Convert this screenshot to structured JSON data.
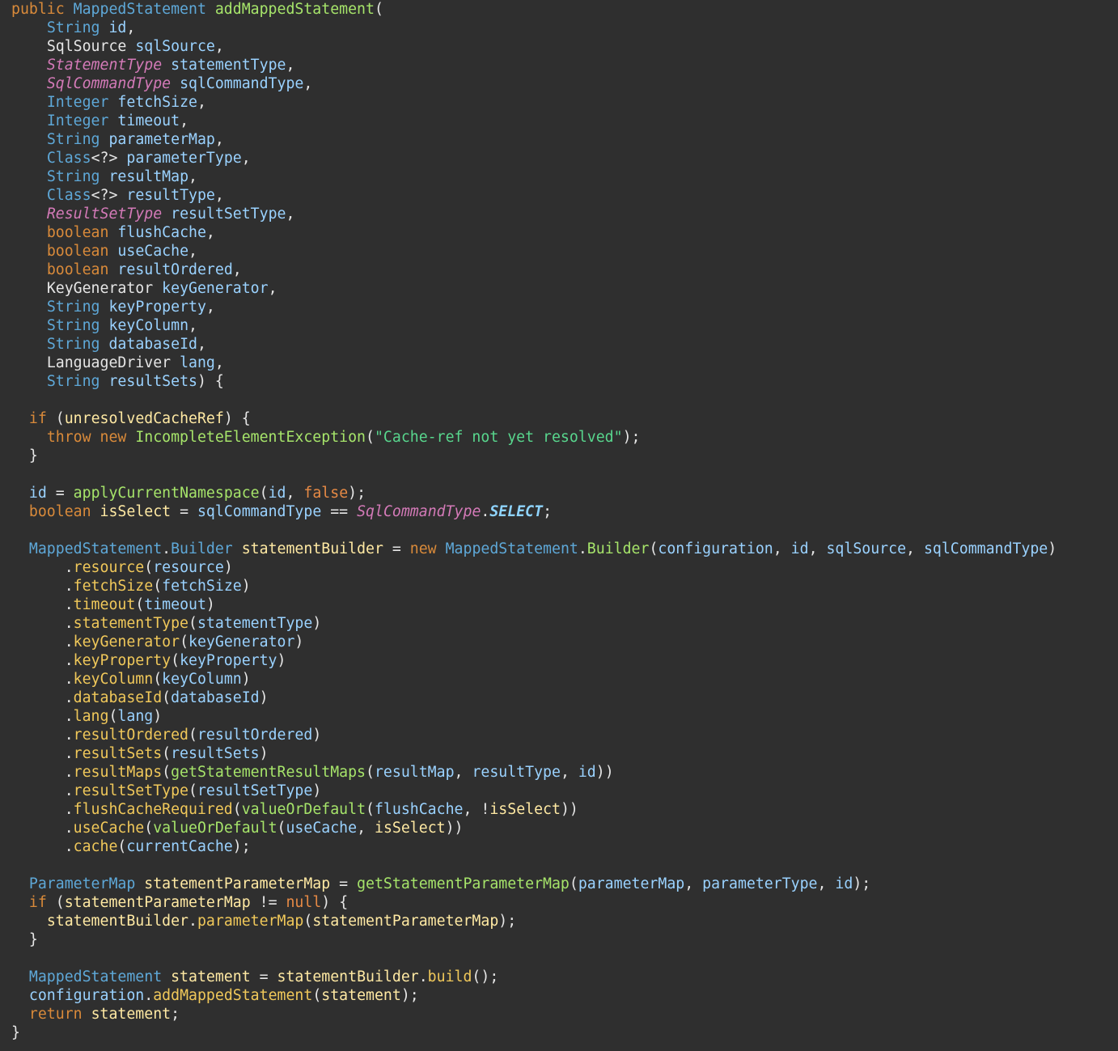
{
  "colors": {
    "background": "#2f2f2f",
    "keyword": "#d98a3a",
    "type": "#5ea8d8",
    "type_plain": "#e6e6e6",
    "enum_type": "#d47ab8",
    "variable": "#ffe9a3",
    "parameter": "#9ad2ff",
    "method": "#f0c85a",
    "method_call": "#a6e46a",
    "string": "#58d68d",
    "constant": "#8fd4ff",
    "literal": "#e78a45",
    "punctuation": "#e6e6e6"
  },
  "code": {
    "lines": [
      [
        [
          "kw",
          "public "
        ],
        [
          "type",
          "MappedStatement "
        ],
        [
          "mcall",
          "addMappedStatement"
        ],
        [
          "punc",
          "("
        ]
      ],
      [
        [
          "punc",
          "    "
        ],
        [
          "type",
          "String "
        ],
        [
          "param",
          "id"
        ],
        [
          "punc",
          ","
        ]
      ],
      [
        [
          "punc",
          "    "
        ],
        [
          "plaintype",
          "SqlSource "
        ],
        [
          "param",
          "sqlSource"
        ],
        [
          "punc",
          ","
        ]
      ],
      [
        [
          "punc",
          "    "
        ],
        [
          "enum",
          "StatementType "
        ],
        [
          "param",
          "statementType"
        ],
        [
          "punc",
          ","
        ]
      ],
      [
        [
          "punc",
          "    "
        ],
        [
          "enum",
          "SqlCommandType "
        ],
        [
          "param",
          "sqlCommandType"
        ],
        [
          "punc",
          ","
        ]
      ],
      [
        [
          "punc",
          "    "
        ],
        [
          "type",
          "Integer "
        ],
        [
          "param",
          "fetchSize"
        ],
        [
          "punc",
          ","
        ]
      ],
      [
        [
          "punc",
          "    "
        ],
        [
          "type",
          "Integer "
        ],
        [
          "param",
          "timeout"
        ],
        [
          "punc",
          ","
        ]
      ],
      [
        [
          "punc",
          "    "
        ],
        [
          "type",
          "String "
        ],
        [
          "param",
          "parameterMap"
        ],
        [
          "punc",
          ","
        ]
      ],
      [
        [
          "punc",
          "    "
        ],
        [
          "type",
          "Class"
        ],
        [
          "punc",
          "<?> "
        ],
        [
          "param",
          "parameterType"
        ],
        [
          "punc",
          ","
        ]
      ],
      [
        [
          "punc",
          "    "
        ],
        [
          "type",
          "String "
        ],
        [
          "param",
          "resultMap"
        ],
        [
          "punc",
          ","
        ]
      ],
      [
        [
          "punc",
          "    "
        ],
        [
          "type",
          "Class"
        ],
        [
          "punc",
          "<?> "
        ],
        [
          "param",
          "resultType"
        ],
        [
          "punc",
          ","
        ]
      ],
      [
        [
          "punc",
          "    "
        ],
        [
          "enum",
          "ResultSetType "
        ],
        [
          "param",
          "resultSetType"
        ],
        [
          "punc",
          ","
        ]
      ],
      [
        [
          "punc",
          "    "
        ],
        [
          "kw",
          "boolean "
        ],
        [
          "param",
          "flushCache"
        ],
        [
          "punc",
          ","
        ]
      ],
      [
        [
          "punc",
          "    "
        ],
        [
          "kw",
          "boolean "
        ],
        [
          "param",
          "useCache"
        ],
        [
          "punc",
          ","
        ]
      ],
      [
        [
          "punc",
          "    "
        ],
        [
          "kw",
          "boolean "
        ],
        [
          "param",
          "resultOrdered"
        ],
        [
          "punc",
          ","
        ]
      ],
      [
        [
          "punc",
          "    "
        ],
        [
          "plaintype",
          "KeyGenerator "
        ],
        [
          "param",
          "keyGenerator"
        ],
        [
          "punc",
          ","
        ]
      ],
      [
        [
          "punc",
          "    "
        ],
        [
          "type",
          "String "
        ],
        [
          "param",
          "keyProperty"
        ],
        [
          "punc",
          ","
        ]
      ],
      [
        [
          "punc",
          "    "
        ],
        [
          "type",
          "String "
        ],
        [
          "param",
          "keyColumn"
        ],
        [
          "punc",
          ","
        ]
      ],
      [
        [
          "punc",
          "    "
        ],
        [
          "type",
          "String "
        ],
        [
          "param",
          "databaseId"
        ],
        [
          "punc",
          ","
        ]
      ],
      [
        [
          "punc",
          "    "
        ],
        [
          "plaintype",
          "LanguageDriver "
        ],
        [
          "param",
          "lang"
        ],
        [
          "punc",
          ","
        ]
      ],
      [
        [
          "punc",
          "    "
        ],
        [
          "type",
          "String "
        ],
        [
          "param",
          "resultSets"
        ],
        [
          "punc",
          ") {"
        ]
      ],
      [],
      [
        [
          "punc",
          "  "
        ],
        [
          "kw",
          "if "
        ],
        [
          "punc",
          "("
        ],
        [
          "var",
          "unresolvedCacheRef"
        ],
        [
          "punc",
          ") {"
        ]
      ],
      [
        [
          "punc",
          "    "
        ],
        [
          "kw",
          "throw new "
        ],
        [
          "mcall",
          "IncompleteElementException"
        ],
        [
          "punc",
          "("
        ],
        [
          "str",
          "\"Cache-ref not yet resolved\""
        ],
        [
          "punc",
          ");"
        ]
      ],
      [
        [
          "punc",
          "  }"
        ]
      ],
      [],
      [
        [
          "punc",
          "  "
        ],
        [
          "param",
          "id "
        ],
        [
          "punc",
          "= "
        ],
        [
          "mcall",
          "applyCurrentNamespace"
        ],
        [
          "punc",
          "("
        ],
        [
          "param",
          "id"
        ],
        [
          "punc",
          ", "
        ],
        [
          "lit",
          "false"
        ],
        [
          "punc",
          ");"
        ]
      ],
      [
        [
          "punc",
          "  "
        ],
        [
          "kw",
          "boolean "
        ],
        [
          "var",
          "isSelect "
        ],
        [
          "punc",
          "= "
        ],
        [
          "param",
          "sqlCommandType "
        ],
        [
          "punc",
          "== "
        ],
        [
          "enum",
          "SqlCommandType"
        ],
        [
          "punc",
          "."
        ],
        [
          "const",
          "SELECT"
        ],
        [
          "punc",
          ";"
        ]
      ],
      [],
      [
        [
          "punc",
          "  "
        ],
        [
          "type",
          "MappedStatement"
        ],
        [
          "punc",
          "."
        ],
        [
          "type",
          "Builder "
        ],
        [
          "var",
          "statementBuilder "
        ],
        [
          "punc",
          "= "
        ],
        [
          "kw",
          "new "
        ],
        [
          "type",
          "MappedStatement"
        ],
        [
          "punc",
          "."
        ],
        [
          "mcall",
          "Builder"
        ],
        [
          "punc",
          "("
        ],
        [
          "param",
          "configuration"
        ],
        [
          "punc",
          ", "
        ],
        [
          "param",
          "id"
        ],
        [
          "punc",
          ", "
        ],
        [
          "param",
          "sqlSource"
        ],
        [
          "punc",
          ", "
        ],
        [
          "param",
          "sqlCommandType"
        ],
        [
          "punc",
          ")"
        ]
      ],
      [
        [
          "punc",
          "      ."
        ],
        [
          "method",
          "resource"
        ],
        [
          "punc",
          "("
        ],
        [
          "param",
          "resource"
        ],
        [
          "punc",
          ")"
        ]
      ],
      [
        [
          "punc",
          "      ."
        ],
        [
          "method",
          "fetchSize"
        ],
        [
          "punc",
          "("
        ],
        [
          "param",
          "fetchSize"
        ],
        [
          "punc",
          ")"
        ]
      ],
      [
        [
          "punc",
          "      ."
        ],
        [
          "method",
          "timeout"
        ],
        [
          "punc",
          "("
        ],
        [
          "param",
          "timeout"
        ],
        [
          "punc",
          ")"
        ]
      ],
      [
        [
          "punc",
          "      ."
        ],
        [
          "method",
          "statementType"
        ],
        [
          "punc",
          "("
        ],
        [
          "param",
          "statementType"
        ],
        [
          "punc",
          ")"
        ]
      ],
      [
        [
          "punc",
          "      ."
        ],
        [
          "method",
          "keyGenerator"
        ],
        [
          "punc",
          "("
        ],
        [
          "param",
          "keyGenerator"
        ],
        [
          "punc",
          ")"
        ]
      ],
      [
        [
          "punc",
          "      ."
        ],
        [
          "method",
          "keyProperty"
        ],
        [
          "punc",
          "("
        ],
        [
          "param",
          "keyProperty"
        ],
        [
          "punc",
          ")"
        ]
      ],
      [
        [
          "punc",
          "      ."
        ],
        [
          "method",
          "keyColumn"
        ],
        [
          "punc",
          "("
        ],
        [
          "param",
          "keyColumn"
        ],
        [
          "punc",
          ")"
        ]
      ],
      [
        [
          "punc",
          "      ."
        ],
        [
          "method",
          "databaseId"
        ],
        [
          "punc",
          "("
        ],
        [
          "param",
          "databaseId"
        ],
        [
          "punc",
          ")"
        ]
      ],
      [
        [
          "punc",
          "      ."
        ],
        [
          "method",
          "lang"
        ],
        [
          "punc",
          "("
        ],
        [
          "param",
          "lang"
        ],
        [
          "punc",
          ")"
        ]
      ],
      [
        [
          "punc",
          "      ."
        ],
        [
          "method",
          "resultOrdered"
        ],
        [
          "punc",
          "("
        ],
        [
          "param",
          "resultOrdered"
        ],
        [
          "punc",
          ")"
        ]
      ],
      [
        [
          "punc",
          "      ."
        ],
        [
          "method",
          "resultSets"
        ],
        [
          "punc",
          "("
        ],
        [
          "param",
          "resultSets"
        ],
        [
          "punc",
          ")"
        ]
      ],
      [
        [
          "punc",
          "      ."
        ],
        [
          "method",
          "resultMaps"
        ],
        [
          "punc",
          "("
        ],
        [
          "mcall",
          "getStatementResultMaps"
        ],
        [
          "punc",
          "("
        ],
        [
          "param",
          "resultMap"
        ],
        [
          "punc",
          ", "
        ],
        [
          "param",
          "resultType"
        ],
        [
          "punc",
          ", "
        ],
        [
          "param",
          "id"
        ],
        [
          "punc",
          "))"
        ]
      ],
      [
        [
          "punc",
          "      ."
        ],
        [
          "method",
          "resultSetType"
        ],
        [
          "punc",
          "("
        ],
        [
          "param",
          "resultSetType"
        ],
        [
          "punc",
          ")"
        ]
      ],
      [
        [
          "punc",
          "      ."
        ],
        [
          "method",
          "flushCacheRequired"
        ],
        [
          "punc",
          "("
        ],
        [
          "mcall",
          "valueOrDefault"
        ],
        [
          "punc",
          "("
        ],
        [
          "param",
          "flushCache"
        ],
        [
          "punc",
          ", !"
        ],
        [
          "var",
          "isSelect"
        ],
        [
          "punc",
          "))"
        ]
      ],
      [
        [
          "punc",
          "      ."
        ],
        [
          "method",
          "useCache"
        ],
        [
          "punc",
          "("
        ],
        [
          "mcall",
          "valueOrDefault"
        ],
        [
          "punc",
          "("
        ],
        [
          "param",
          "useCache"
        ],
        [
          "punc",
          ", "
        ],
        [
          "var",
          "isSelect"
        ],
        [
          "punc",
          "))"
        ]
      ],
      [
        [
          "punc",
          "      ."
        ],
        [
          "method",
          "cache"
        ],
        [
          "punc",
          "("
        ],
        [
          "param",
          "currentCache"
        ],
        [
          "punc",
          ");"
        ]
      ],
      [],
      [
        [
          "punc",
          "  "
        ],
        [
          "type",
          "ParameterMap "
        ],
        [
          "var",
          "statementParameterMap "
        ],
        [
          "punc",
          "= "
        ],
        [
          "mcall",
          "getStatementParameterMap"
        ],
        [
          "punc",
          "("
        ],
        [
          "param",
          "parameterMap"
        ],
        [
          "punc",
          ", "
        ],
        [
          "param",
          "parameterType"
        ],
        [
          "punc",
          ", "
        ],
        [
          "param",
          "id"
        ],
        [
          "punc",
          ");"
        ]
      ],
      [
        [
          "punc",
          "  "
        ],
        [
          "kw",
          "if "
        ],
        [
          "punc",
          "("
        ],
        [
          "var",
          "statementParameterMap "
        ],
        [
          "punc",
          "!= "
        ],
        [
          "lit",
          "null"
        ],
        [
          "punc",
          ") {"
        ]
      ],
      [
        [
          "punc",
          "    "
        ],
        [
          "var",
          "statementBuilder"
        ],
        [
          "punc",
          "."
        ],
        [
          "method",
          "parameterMap"
        ],
        [
          "punc",
          "("
        ],
        [
          "var",
          "statementParameterMap"
        ],
        [
          "punc",
          ");"
        ]
      ],
      [
        [
          "punc",
          "  }"
        ]
      ],
      [],
      [
        [
          "punc",
          "  "
        ],
        [
          "type",
          "MappedStatement "
        ],
        [
          "var",
          "statement "
        ],
        [
          "punc",
          "= "
        ],
        [
          "var",
          "statementBuilder"
        ],
        [
          "punc",
          "."
        ],
        [
          "method",
          "build"
        ],
        [
          "punc",
          "();"
        ]
      ],
      [
        [
          "punc",
          "  "
        ],
        [
          "param",
          "configuration"
        ],
        [
          "punc",
          "."
        ],
        [
          "method",
          "addMappedStatement"
        ],
        [
          "punc",
          "("
        ],
        [
          "var",
          "statement"
        ],
        [
          "punc",
          ");"
        ]
      ],
      [
        [
          "punc",
          "  "
        ],
        [
          "kw",
          "return "
        ],
        [
          "var",
          "statement"
        ],
        [
          "punc",
          ";"
        ]
      ],
      [
        [
          "punc",
          "}"
        ]
      ]
    ]
  }
}
